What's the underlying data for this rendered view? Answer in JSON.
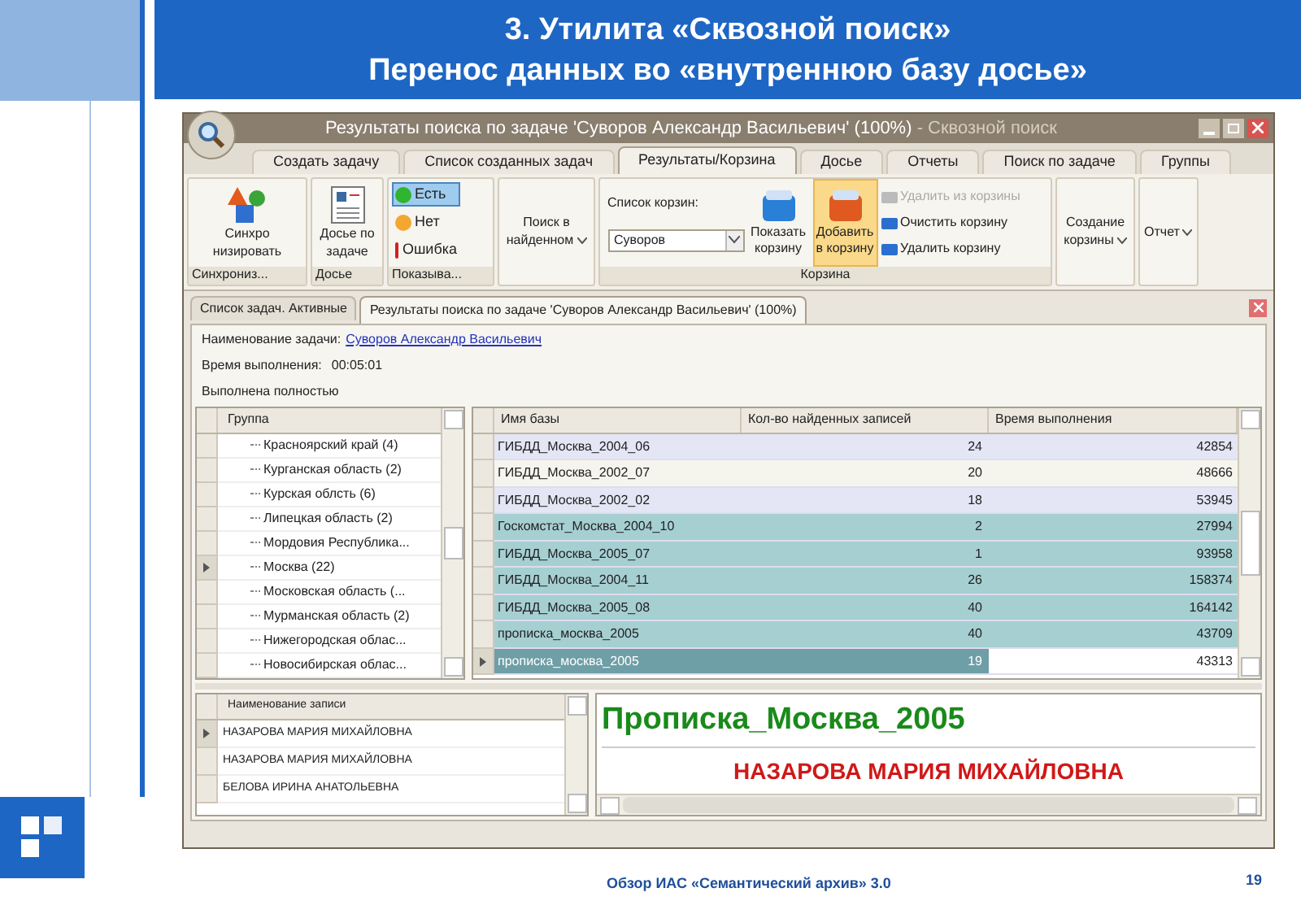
{
  "slide": {
    "title_lines": [
      "3. Утилита «Сквозной поиск»",
      "Перенос данных во «внутреннюю базу досье»"
    ],
    "footer": "Обзор ИАС «Семантический архив» 3.0",
    "page": "19"
  },
  "window": {
    "title": "Результаты поиска по задаче 'Суворов Александр Васильевич' (100%)",
    "app": " - Сквозной поиск"
  },
  "ribbon_tabs": [
    {
      "label": "Создать задачу",
      "selected": false
    },
    {
      "label": "Список созданных задач",
      "selected": false
    },
    {
      "label": "Результаты/Корзина",
      "selected": true
    },
    {
      "label": "Досье",
      "selected": false
    },
    {
      "label": "Отчеты",
      "selected": false
    },
    {
      "label": "Поиск по задаче",
      "selected": false
    },
    {
      "label": "Группы",
      "selected": false
    }
  ],
  "ribbon": {
    "sync": {
      "label": "Синхро низировать",
      "caption": "Синхрониз..."
    },
    "dossier": {
      "label": "Досье по задаче",
      "caption": "Досье"
    },
    "show": {
      "caption": "Показыва...",
      "items": [
        {
          "label": "Есть",
          "color": "#2fb52f",
          "selected": true
        },
        {
          "label": "Нет",
          "color": "#f2a830",
          "selected": false
        },
        {
          "label": "Ошибка",
          "color": "#d42020",
          "selected": false
        }
      ]
    },
    "search_in_found": {
      "label": "Поиск в найденном"
    },
    "basket": {
      "caption": "Корзина",
      "list_label": "Список корзин:",
      "list_value": "Суворов",
      "show_label": "Показать корзину",
      "add_label": "Добавить в корзину",
      "actions": [
        {
          "label": "Удалить из корзины",
          "disabled": true
        },
        {
          "label": "Очистить корзину",
          "disabled": false
        },
        {
          "label": "Удалить корзину",
          "disabled": false
        }
      ]
    },
    "create": {
      "label": "Создание корзины"
    },
    "report": {
      "label": "Отчет"
    }
  },
  "doc_tabs": [
    {
      "label": "Список задач. Активные",
      "selected": false
    },
    {
      "label": "Результаты поиска по задаче 'Суворов Александр Васильевич' (100%)",
      "selected": true
    }
  ],
  "task": {
    "name_label": "Наименование задачи:",
    "name_value": "Суворов Александр Васильевич",
    "time_label": "Время выполнения:",
    "time_value": "00:05:01",
    "status": "Выполнена полностью"
  },
  "groups": {
    "header": "Группа",
    "items": [
      {
        "label": "Красноярский край (4)",
        "current": false
      },
      {
        "label": "Курганская область (2)",
        "current": false
      },
      {
        "label": "Курская облсть (6)",
        "current": false
      },
      {
        "label": "Липецкая область (2)",
        "current": false
      },
      {
        "label": "Мордовия Республика...",
        "current": false
      },
      {
        "label": "Москва (22)",
        "current": true
      },
      {
        "label": "Московская область (...",
        "current": false
      },
      {
        "label": "Мурманская область (2)",
        "current": false
      },
      {
        "label": "Нижегородская облас...",
        "current": false
      },
      {
        "label": "Новосибирская облас...",
        "current": false
      }
    ]
  },
  "results": {
    "columns": [
      "Имя базы",
      "Кол-во найденных записей",
      "Время выполнения"
    ],
    "rows": [
      {
        "cells": [
          "ГИБДД_Москва_2004_06",
          "24",
          "42854"
        ],
        "selected": false,
        "current": false
      },
      {
        "cells": [
          "ГИБДД_Москва_2002_07",
          "20",
          "48666"
        ],
        "selected": false,
        "current": false
      },
      {
        "cells": [
          "ГИБДД_Москва_2002_02",
          "18",
          "53945"
        ],
        "selected": false,
        "current": false
      },
      {
        "cells": [
          "Госкомстат_Москва_2004_10",
          "2",
          "27994"
        ],
        "selected": true,
        "current": false
      },
      {
        "cells": [
          "ГИБДД_Москва_2005_07",
          "1",
          "93958"
        ],
        "selected": true,
        "current": false
      },
      {
        "cells": [
          "ГИБДД_Москва_2004_11",
          "26",
          "158374"
        ],
        "selected": true,
        "current": false
      },
      {
        "cells": [
          "ГИБДД_Москва_2005_08",
          "40",
          "164142"
        ],
        "selected": true,
        "current": false
      },
      {
        "cells": [
          "прописка_москва_2005",
          "40",
          "43709"
        ],
        "selected": true,
        "current": false
      },
      {
        "cells": [
          "прописка_москва_2005",
          "19",
          "43313"
        ],
        "selected": true,
        "current": true
      }
    ]
  },
  "records": {
    "header": "Наименование записи",
    "rows": [
      {
        "label": "НАЗАРОВА МАРИЯ МИХАЙЛОВНА",
        "current": true
      },
      {
        "label": "НАЗАРОВА МАРИЯ МИХАЙЛОВНА",
        "current": false
      },
      {
        "label": "БЕЛОВА ИРИНА АНАТОЛЬЕВНА",
        "current": false
      }
    ]
  },
  "preview": {
    "title": "Прописка_Москва_2005",
    "name": "НАЗАРОВА МАРИЯ МИХАЙЛОВНА"
  }
}
